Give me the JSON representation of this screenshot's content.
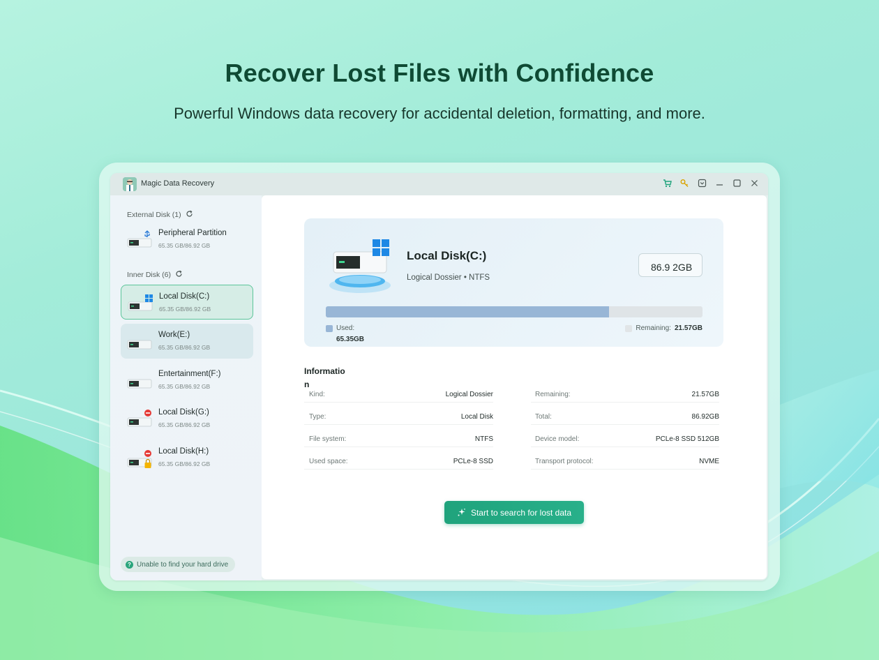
{
  "hero": {
    "title": "Recover Lost Files with Confidence",
    "subtitle": "Powerful Windows data recovery for accidental deletion, formatting, and more."
  },
  "window": {
    "title": "Magic Data Recovery",
    "controls": [
      "cart-icon",
      "key-icon",
      "dropdown-icon",
      "minimize-icon",
      "maximize-icon",
      "close-icon"
    ]
  },
  "sidebar": {
    "external_label": "External Disk (1)",
    "inner_label": "Inner Disk (6)",
    "external_disks": [
      {
        "name": "Peripheral Partition",
        "size": "65.35 GB/86.92 GB",
        "badge": "usb-icon"
      }
    ],
    "inner_disks": [
      {
        "name": "Local Disk(C:)",
        "size": "65.35 GB/86.92 GB",
        "badge": "windows-icon",
        "state": "selected"
      },
      {
        "name": "Work(E:)",
        "size": "65.35 GB/86.92 GB",
        "badge": "",
        "state": "hover"
      },
      {
        "name": "Entertainment(F:)",
        "size": "65.35 GB/86.92 GB",
        "badge": ""
      },
      {
        "name": "Local Disk(G:)",
        "size": "65.35 GB/86.92 GB",
        "badge": "error-icon"
      },
      {
        "name": "Local Disk(H:)",
        "size": "65.35 GB/86.92 GB",
        "badge": "error-lock-icon"
      }
    ],
    "help": "Unable to find your hard drive"
  },
  "disk_card": {
    "name": "Local Disk(C:)",
    "meta": "Logical Dossier • NTFS",
    "size_box": "86.9 2GB",
    "used_fraction": 0.752,
    "used_label": "Used:",
    "used_value": "65.35GB",
    "remaining_label": "Remaining:",
    "remaining_value": "21.57GB",
    "colors": {
      "used": "#98b6d6",
      "remaining": "#dfe4e7"
    }
  },
  "info": {
    "heading": "Information",
    "rows": [
      {
        "k1": "Kind:",
        "v1": "Logical Dossier",
        "k2": "Remaining:",
        "v2": "21.57GB"
      },
      {
        "k1": "Type:",
        "v1": "Local Disk",
        "k2": "Total:",
        "v2": "86.92GB"
      },
      {
        "k1": "File system:",
        "v1": "NTFS",
        "k2": "Device model:",
        "v2": "PCLe-8 SSD 512GB"
      },
      {
        "k1": "Used space:",
        "v1": "PCLe-8 SSD",
        "k2": "Transport protocol:",
        "v2": "NVME"
      }
    ]
  },
  "cta": {
    "label": "Start to search for lost data",
    "icon": "sparkle-icon"
  },
  "accent": "#1fa37c"
}
